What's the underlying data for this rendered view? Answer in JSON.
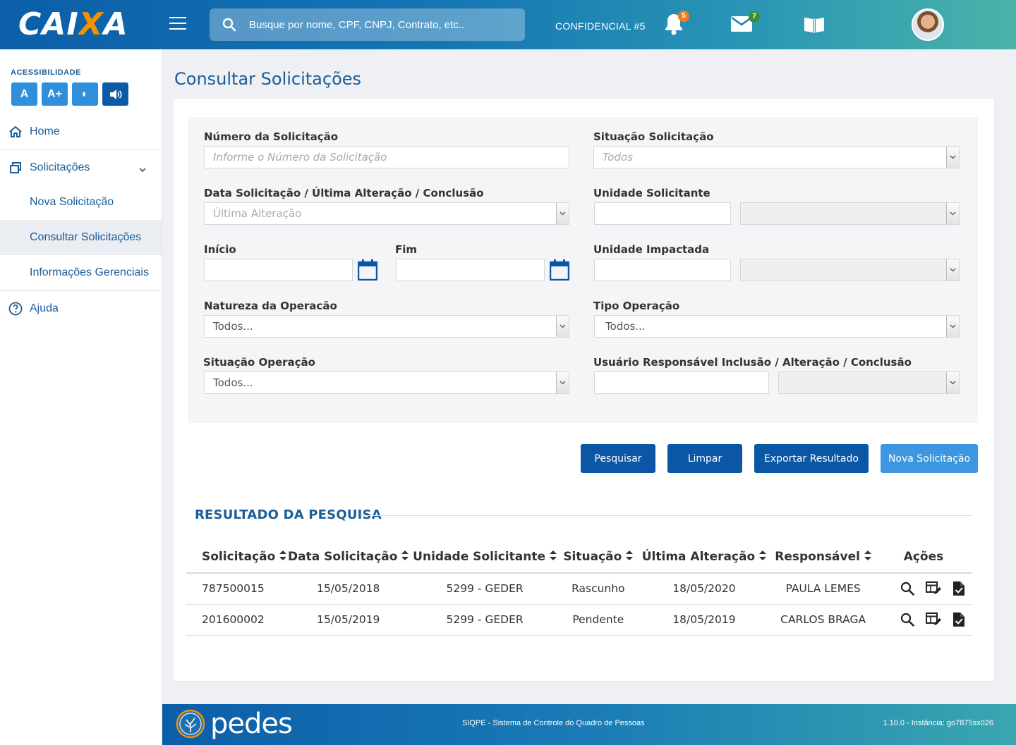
{
  "header": {
    "logo_main": "CAI",
    "logo_x": "X",
    "logo_end": "A",
    "search_placeholder": "Busque por nome, CPF, CNPJ, Contrato, etc..",
    "confidential": "CONFIDENCIAL #5",
    "notifications_count": "5",
    "messages_count": "7",
    "colors": {
      "notif_badge": "#f07c1a",
      "msg_badge": "#3c8d2f"
    }
  },
  "sidebar": {
    "accessibility_label": "ACESSIBILIDADE",
    "acc_buttons": [
      "A",
      "A+",
      "◐",
      "🔊"
    ],
    "items": [
      {
        "label": "Home",
        "icon": "home-icon"
      },
      {
        "label": "Solicitações",
        "icon": "windows-icon"
      },
      {
        "label": "Nova Solicitação"
      },
      {
        "label": "Consultar Solicitações"
      },
      {
        "label": "Informações Gerenciais"
      },
      {
        "label": "Ajuda",
        "icon": "help-icon"
      }
    ]
  },
  "page": {
    "title": "Consultar Solicitações"
  },
  "filters": {
    "numero_label": "Número da Solicitação",
    "numero_placeholder": "Informe o Número da Solicitação",
    "situacao_sol_label": "Situação Solicitação",
    "situacao_sol_value": "Todos",
    "data_label": "Data Solicitação / Última Alteração / Conclusão",
    "data_value": "Última Alteração",
    "unidade_sol_label": "Unidade Solicitante",
    "inicio_label": "Início",
    "fim_label": "Fim",
    "unidade_imp_label": "Unidade Impactada",
    "natureza_label": "Natureza da Operacão",
    "natureza_value": "Todos...",
    "tipo_label": "Tipo Operação",
    "tipo_value": "Todos...",
    "situacao_op_label": "Situação Operação",
    "situacao_op_value": "Todos...",
    "usuario_label": "Usuário Responsável Inclusão / Alteração / Conclusão"
  },
  "buttons": {
    "pesquisar": "Pesquisar",
    "limpar": "Limpar",
    "exportar": "Exportar Resultado",
    "nova": "Nova Solicitação"
  },
  "results": {
    "title": "RESULTADO DA PESQUISA",
    "columns": [
      "Solicitação",
      "Data Solicitação",
      "Unidade Solicitante",
      "Situação",
      "Última Alteração",
      "Responsável",
      "Ações"
    ],
    "rows": [
      [
        "787500015",
        "15/05/2018",
        "5299 - GEDER",
        "Rascunho",
        "18/05/2020",
        "PAULA LEMES"
      ],
      [
        "201600002",
        "15/05/2019",
        "5299 - GEDER",
        "Pendente",
        "18/05/2019",
        "CARLOS BRAGA"
      ]
    ]
  },
  "footer": {
    "brand": "pedes",
    "system": "SIQPE  - Sistema de Controle do Quadro de Pessoas",
    "version": "1.10.0 - Instância: go7875sx026"
  }
}
